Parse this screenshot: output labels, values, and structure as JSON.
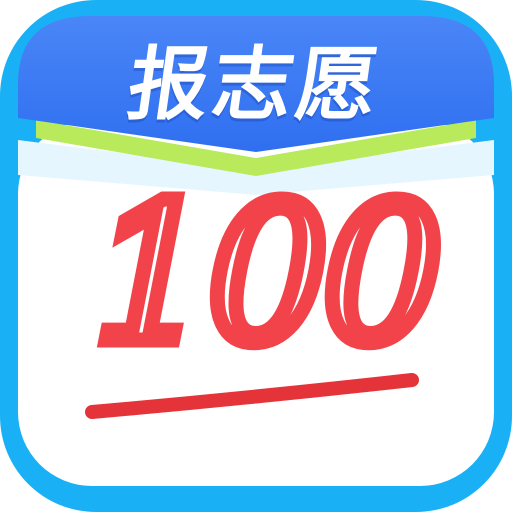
{
  "icon": {
    "banner_text": "报志愿",
    "score_text": "100",
    "colors": {
      "background": "#1ab0f5",
      "banner": "#2f6ff0",
      "banner_top": "#4a86f7",
      "book_green": "#b8ea5c",
      "book_light": "#e6f6ff",
      "paper": "#ffffff",
      "score_red": "#f2434a",
      "underline_red": "#e5333a"
    },
    "semantic": [
      "book-icon",
      "score-100-icon"
    ]
  }
}
